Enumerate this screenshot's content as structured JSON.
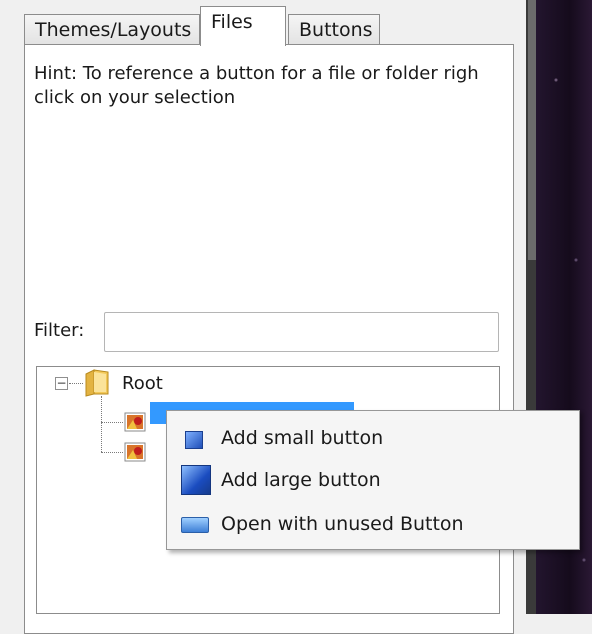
{
  "tabs": [
    {
      "label": "Themes/Layouts"
    },
    {
      "label": "Files"
    },
    {
      "label": "Buttons"
    }
  ],
  "hint": {
    "line1": "Hint: To reference a button for a file or folder righ",
    "line2": "click on your selection"
  },
  "filter": {
    "label": "Filter:",
    "value": ""
  },
  "tree": {
    "expander": "−",
    "root_label": "Root"
  },
  "context_menu": {
    "items": [
      {
        "label": "Add small button",
        "icon": "small-button-icon"
      },
      {
        "label": "Add large button",
        "icon": "large-button-icon"
      },
      {
        "label": "Open with unused Button",
        "icon": "open-button-icon"
      }
    ]
  },
  "colors": {
    "selection": "#3399ff",
    "desktop": "#1b0f24"
  }
}
